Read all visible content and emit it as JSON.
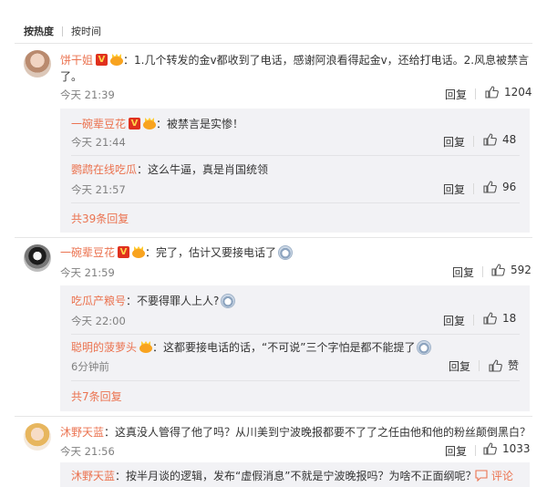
{
  "sort": {
    "hot": "按热度",
    "time": "按时间"
  },
  "actions": {
    "reply": "回复",
    "like": "赞",
    "comment": "评论"
  },
  "comments": [
    {
      "user": "饼干姐",
      "line1": "：1.几个转发的金v都收到了电话，感谢阿浪看得起金v，还给打电话。2.风息被禁言",
      "line2": "了。",
      "time": "今天 21:39",
      "likes": "1204",
      "replies": [
        {
          "user": "一碗辈豆花",
          "text": "：被禁言是实惨！",
          "time": "今天 21:44",
          "likes": "48"
        },
        {
          "user": "鹦鹉在线吃瓜",
          "text": "：这么牛逼，真是肖国统领",
          "time": "今天 21:57",
          "likes": "96"
        }
      ],
      "more": "共39条回复"
    },
    {
      "user": "一碗辈豆花",
      "text": "：完了，估计又要接电话了",
      "time": "今天 21:59",
      "likes": "592",
      "replies": [
        {
          "user": "吃瓜产粮号",
          "text": "：不要得罪人上人?",
          "time": "今天 22:00",
          "likes": "18"
        },
        {
          "user": "聪明的菠萝头",
          "text": "：这都要接电话的话，“不可说”三个字怕是都不能提了",
          "time": "6分钟前",
          "likes": "赞"
        }
      ],
      "more": "共7条回复"
    },
    {
      "user": "沐野天蓝",
      "text": "：这真没人管得了他了吗？从川美到宁波晚报都要不了了之任由他和他的粉丝颠倒黑白？",
      "time": "今天 21:56",
      "likes": "1033",
      "replies": [
        {
          "user": "沐野天蓝",
          "text": "：按半月谈的逻辑，发布“虚假消息”不就是宁波晚报吗？为啥不正面纲呢？"
        }
      ]
    }
  ]
}
